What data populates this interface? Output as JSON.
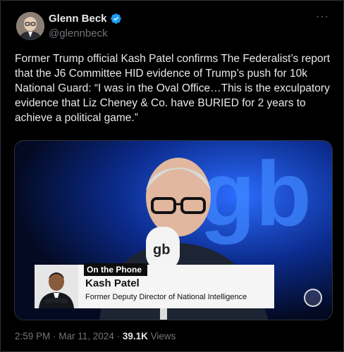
{
  "author": {
    "display_name": "Glenn Beck",
    "handle": "@glennbeck",
    "verified_color": "#1d9bf0",
    "avatar_icon": "person-avatar-icon"
  },
  "more_label": "···",
  "tweet": {
    "text": "Former Trump official Kash Patel confirms The Federalist’s report that the J6 Committee HID evidence of Trump’s push for 10k National Guard: “I was in the Oval Office…This is the exculpatory evidence that Liz Cheney & Co. have BURIED for 2 years to achieve a political game.”"
  },
  "media": {
    "logo_text": "gb",
    "mic_text": "gb",
    "lower_third": {
      "tag": "On the Phone",
      "name": "Kash Patel",
      "title": "Former Deputy Director of National Intelligence"
    }
  },
  "meta": {
    "time": "2:59 PM",
    "separator": " · ",
    "date": "Mar 11, 2024",
    "views_count": "39.1K",
    "views_label": " Views"
  },
  "colors": {
    "background": "#000000",
    "text": "#e7e9ea",
    "muted": "#71767b",
    "studio_blue": "#1c4fd6"
  }
}
